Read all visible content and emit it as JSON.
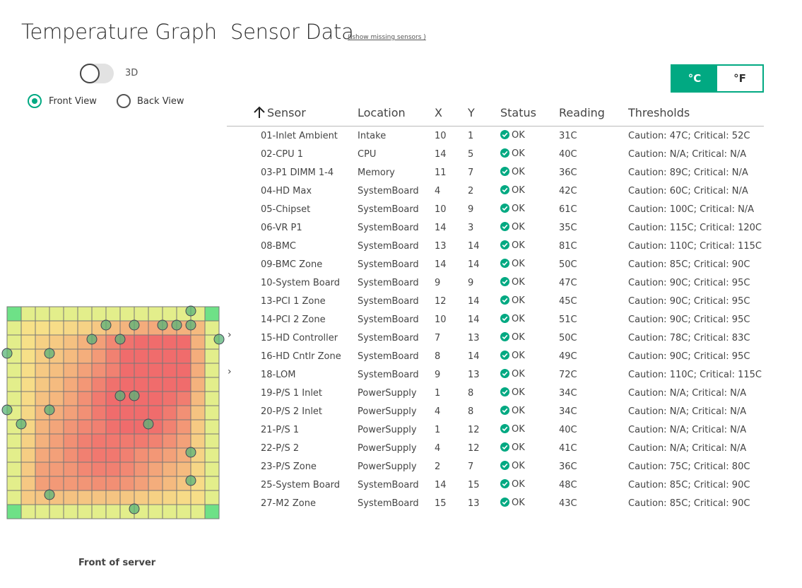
{
  "header": {
    "graph_title": "Temperature Graph",
    "sensor_title": "Sensor Data",
    "show_missing_link": "( show missing sensors )"
  },
  "view_controls": {
    "toggle_label": "3D",
    "toggle_on": false,
    "front_view_label": "Front View",
    "back_view_label": "Back View",
    "selected_view": "front"
  },
  "units": {
    "celsius_label": "°C",
    "fahrenheit_label": "°F",
    "selected": "C",
    "accent_color": "#01a982"
  },
  "table": {
    "columns": [
      "Sensor",
      "Location",
      "X",
      "Y",
      "Status",
      "Reading",
      "Thresholds"
    ],
    "sort_icon": "arrow-up-icon",
    "status_icon": "check-circle-icon",
    "rows": [
      {
        "sensor": "01-Inlet Ambient",
        "location": "Intake",
        "x": "10",
        "y": "1",
        "status": "OK",
        "reading": "31C",
        "thresholds": "Caution: 47C; Critical: 52C"
      },
      {
        "sensor": "02-CPU 1",
        "location": "CPU",
        "x": "14",
        "y": "5",
        "status": "OK",
        "reading": "40C",
        "thresholds": "Caution: N/A; Critical: N/A"
      },
      {
        "sensor": "03-P1 DIMM 1-4",
        "location": "Memory",
        "x": "11",
        "y": "7",
        "status": "OK",
        "reading": "36C",
        "thresholds": "Caution: 89C; Critical: N/A"
      },
      {
        "sensor": "04-HD Max",
        "location": "SystemBoard",
        "x": "4",
        "y": "2",
        "status": "OK",
        "reading": "42C",
        "thresholds": "Caution: 60C; Critical: N/A"
      },
      {
        "sensor": "05-Chipset",
        "location": "SystemBoard",
        "x": "10",
        "y": "9",
        "status": "OK",
        "reading": "61C",
        "thresholds": "Caution: 100C; Critical: N/A"
      },
      {
        "sensor": "06-VR P1",
        "location": "SystemBoard",
        "x": "14",
        "y": "3",
        "status": "OK",
        "reading": "35C",
        "thresholds": "Caution: 115C; Critical: 120C"
      },
      {
        "sensor": "08-BMC",
        "location": "SystemBoard",
        "x": "13",
        "y": "14",
        "status": "OK",
        "reading": "81C",
        "thresholds": "Caution: 110C; Critical: 115C"
      },
      {
        "sensor": "09-BMC Zone",
        "location": "SystemBoard",
        "x": "14",
        "y": "14",
        "status": "OK",
        "reading": "50C",
        "thresholds": "Caution: 85C; Critical: 90C"
      },
      {
        "sensor": "10-System Board",
        "location": "SystemBoard",
        "x": "9",
        "y": "9",
        "status": "OK",
        "reading": "47C",
        "thresholds": "Caution: 90C; Critical: 95C"
      },
      {
        "sensor": "13-PCI 1 Zone",
        "location": "SystemBoard",
        "x": "12",
        "y": "14",
        "status": "OK",
        "reading": "45C",
        "thresholds": "Caution: 90C; Critical: 95C"
      },
      {
        "sensor": "14-PCI 2 Zone",
        "location": "SystemBoard",
        "x": "10",
        "y": "14",
        "status": "OK",
        "reading": "51C",
        "thresholds": "Caution: 90C; Critical: 95C"
      },
      {
        "sensor": "15-HD Controller",
        "location": "SystemBoard",
        "x": "7",
        "y": "13",
        "status": "OK",
        "reading": "50C",
        "thresholds": "Caution: 78C; Critical: 83C"
      },
      {
        "sensor": "16-HD Cntlr Zone",
        "location": "SystemBoard",
        "x": "8",
        "y": "14",
        "status": "OK",
        "reading": "49C",
        "thresholds": "Caution: 90C; Critical: 95C"
      },
      {
        "sensor": "18-LOM",
        "location": "SystemBoard",
        "x": "9",
        "y": "13",
        "status": "OK",
        "reading": "72C",
        "thresholds": "Caution: 110C; Critical: 115C"
      },
      {
        "sensor": "19-P/S 1 Inlet",
        "location": "PowerSupply",
        "x": "1",
        "y": "8",
        "status": "OK",
        "reading": "34C",
        "thresholds": "Caution: N/A; Critical: N/A"
      },
      {
        "sensor": "20-P/S 2 Inlet",
        "location": "PowerSupply",
        "x": "4",
        "y": "8",
        "status": "OK",
        "reading": "34C",
        "thresholds": "Caution: N/A; Critical: N/A"
      },
      {
        "sensor": "21-P/S 1",
        "location": "PowerSupply",
        "x": "1",
        "y": "12",
        "status": "OK",
        "reading": "40C",
        "thresholds": "Caution: N/A; Critical: N/A"
      },
      {
        "sensor": "22-P/S 2",
        "location": "PowerSupply",
        "x": "4",
        "y": "12",
        "status": "OK",
        "reading": "41C",
        "thresholds": "Caution: N/A; Critical: N/A"
      },
      {
        "sensor": "23-P/S Zone",
        "location": "PowerSupply",
        "x": "2",
        "y": "7",
        "status": "OK",
        "reading": "36C",
        "thresholds": "Caution: 75C; Critical: 80C"
      },
      {
        "sensor": "25-System Board",
        "location": "SystemBoard",
        "x": "14",
        "y": "15",
        "status": "OK",
        "reading": "48C",
        "thresholds": "Caution: 85C; Critical: 90C"
      },
      {
        "sensor": "27-M2 Zone",
        "location": "SystemBoard",
        "x": "15",
        "y": "13",
        "status": "OK",
        "reading": "43C",
        "thresholds": "Caution: 85C; Critical: 90C"
      }
    ]
  },
  "heatmap": {
    "grid_cols": 15,
    "grid_rows": 15,
    "chevron_icon": "chevron-right-icon",
    "footer_label": "Front of server",
    "colors": {
      "cool": "#70e08a",
      "warm": "#f2f28a",
      "hot": "#f26b6b"
    }
  }
}
